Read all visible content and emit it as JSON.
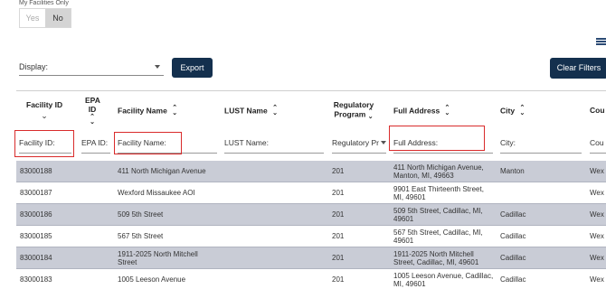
{
  "toggle": {
    "label": "My Facilities Only",
    "yes": "Yes",
    "no": "No"
  },
  "toolbar": {
    "display_label": "Display:",
    "export_label": "Export",
    "clear_filters_label": "Clear Filters"
  },
  "columns": {
    "facility_id": "Facility ID",
    "epa_id": "EPA ID",
    "facility_name": "Facility Name",
    "lust_name": "LUST Name",
    "regulatory_program": "Regulatory Program",
    "full_address": "Full Address",
    "city": "City",
    "county": "Cou"
  },
  "filters": {
    "facility_id": "Facility ID:",
    "epa_id": "EPA ID:",
    "facility_name": "Facility Name:",
    "lust_name": "LUST Name:",
    "regulatory_program": "Regulatory Pr",
    "full_address": "Full Address:",
    "city": "City:",
    "county": "Cou"
  },
  "rows": [
    {
      "facility_id": "83000188",
      "facility_name": "411 North Michigan Avenue",
      "regulatory_program": "201",
      "full_address": "411 North Michigan Avenue, Manton, MI, 49663",
      "city": "Manton",
      "county": "Wex"
    },
    {
      "facility_id": "83000187",
      "facility_name": "Wexford Missaukee AOI",
      "regulatory_program": "201",
      "full_address": "9901 East Thirteenth Street, MI, 49601",
      "city": "",
      "county": "Wex"
    },
    {
      "facility_id": "83000186",
      "facility_name": "509 5th Street",
      "regulatory_program": "201",
      "full_address": "509 5th Street, Cadillac, MI, 49601",
      "city": "Cadillac",
      "county": "Wex"
    },
    {
      "facility_id": "83000185",
      "facility_name": "567 5th Street",
      "regulatory_program": "201",
      "full_address": "567 5th Street, Cadillac, MI, 49601",
      "city": "Cadillac",
      "county": "Wex"
    },
    {
      "facility_id": "83000184",
      "facility_name": "1911-2025 North Mitchell Street",
      "regulatory_program": "201",
      "full_address": "1911-2025 North Mitchell Street, Cadillac, MI, 49601",
      "city": "Cadillac",
      "county": "Wex"
    },
    {
      "facility_id": "83000183",
      "facility_name": "1005 Leeson Avenue",
      "regulatory_program": "201",
      "full_address": "1005 Leeson Avenue, Cadillac, MI, 49601",
      "city": "Cadillac",
      "county": "Wex"
    }
  ]
}
